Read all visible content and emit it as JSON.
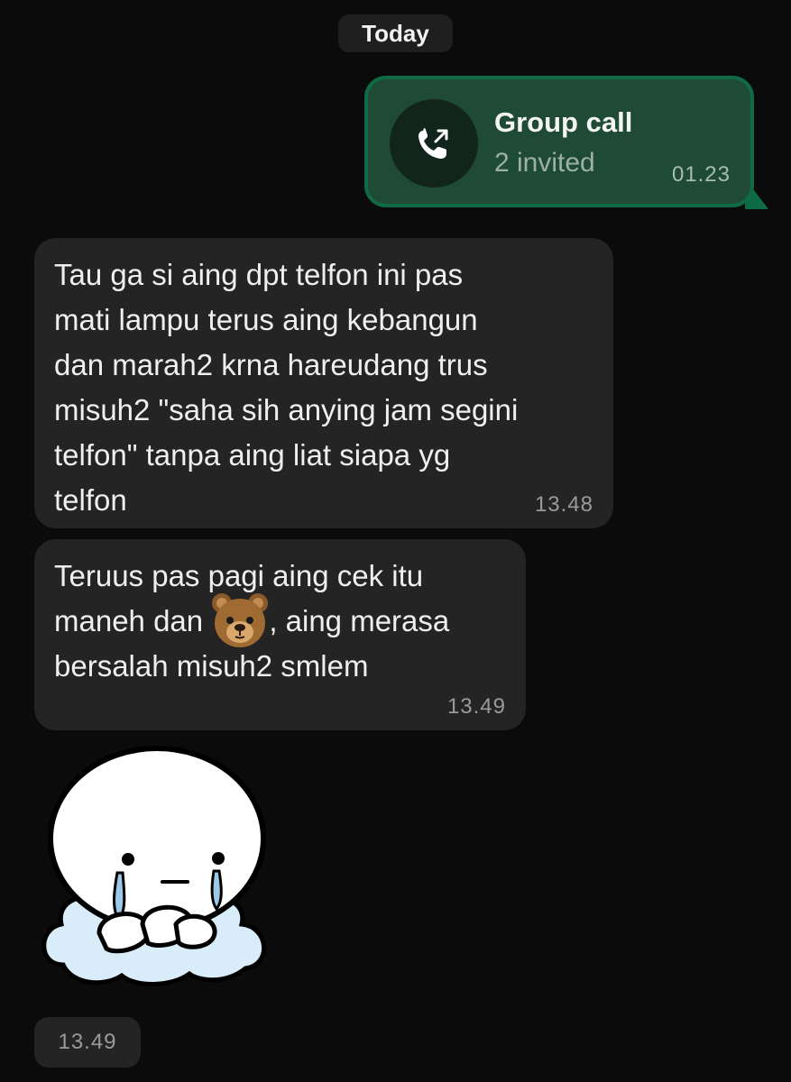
{
  "chat": {
    "date_label": "Today",
    "call": {
      "title": "Group call",
      "subtitle": "2 invited",
      "time": "01.23",
      "icon": "outgoing-call-icon"
    },
    "messages": [
      {
        "text": "Tau ga si aing dpt telfon ini pas\nmati lampu terus aing kebangun\ndan marah2 krna hareudang trus\nmisuh2 \"saha sih anying jam segini\ntelfon\" tanpa aing liat siapa yg\ntelfon",
        "time": "13.48"
      },
      {
        "text_line1": "Teruus pas pagi aing cek itu",
        "text_line2_before": "maneh dan ",
        "emoji": "bear-face-emoji",
        "text_line2_after": ", aing merasa",
        "text_line3": "bersalah misuh2 smlem",
        "time": "13.49"
      }
    ],
    "sticker": {
      "icon": "crying-character-sticker",
      "time": "13.49"
    }
  },
  "colors": {
    "background": "#0b0b0b",
    "incoming_bubble": "#242424",
    "call_bubble": "#1e4a36",
    "call_border": "#0f6b45"
  }
}
